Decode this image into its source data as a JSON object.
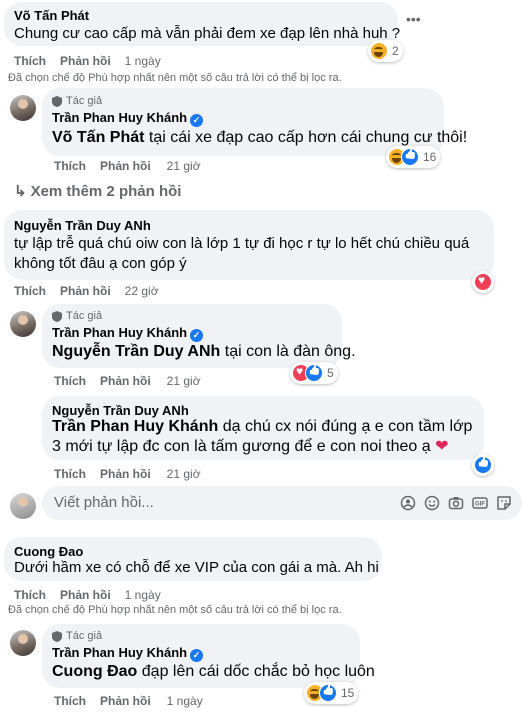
{
  "comments": {
    "c1": {
      "author": "Võ Tấn Phát",
      "text": "Chung cư cao cấp mà vẫn phải đem xe đạp lên nhà huh ?",
      "like": "Thích",
      "reply": "Phản hồi",
      "time": "1 ngày",
      "reaction_count": "2",
      "filter_note": "Đã chọn chế độ Phù hợp nhất nên một số câu trả lời có thể bị lọc ra."
    },
    "r1": {
      "badge": "Tác giả",
      "author": "Trần Phan Huy Khánh",
      "mention": "Võ Tấn Phát",
      "text": " tại cái xe đạp cao cấp hơn cái chung cư thôi!",
      "like": "Thích",
      "reply": "Phản hồi",
      "time": "21 giờ",
      "reaction_count": "16"
    },
    "see_more": "Xem thêm 2 phản hồi",
    "c2": {
      "author": "Nguyễn Trần Duy ANh",
      "text": "tự lập trễ quá chú oiw con là lớp 1 tự đi học r tự lo hết chú chiều quá không tốt đâu ạ con góp ý",
      "like": "Thích",
      "reply": "Phản hồi",
      "time": "22 giờ"
    },
    "r2": {
      "badge": "Tác giả",
      "author": "Trần Phan Huy Khánh",
      "mention": "Nguyễn Trần Duy ANh",
      "text": " tại con là đàn ông.",
      "like": "Thích",
      "reply": "Phản hồi",
      "time": "21 giờ",
      "reaction_count": "5"
    },
    "r3": {
      "author": "Nguyễn Trần Duy ANh",
      "mention": "Trần Phan Huy Khánh",
      "text": " dạ chú cx nói đúng ạ e con tầm lớp 3 mới tự lập đc con là tấm gương để e con noi theo ạ ",
      "heart": "❤",
      "like": "Thích",
      "reply": "Phản hồi",
      "time": "21 giờ"
    },
    "reply_placeholder": "Viết phản hồi...",
    "c3": {
      "author": "Cuong Đao",
      "text": "Dưới hầm xe có chỗ để xe VIP của con gái a mà. Ah hi",
      "like": "Thích",
      "reply": "Phản hồi",
      "time": "1 ngày",
      "filter_note": "Đã chọn chế độ Phù hợp nhất nên một số câu trả lời có thể bị lọc ra."
    },
    "r4": {
      "badge": "Tác giả",
      "author": "Trần Phan Huy Khánh",
      "mention": "Cuong Đao",
      "text": " đạp lên cái dốc chắc bỏ học luôn",
      "like": "Thích",
      "reply": "Phản hồi",
      "time": "1 ngày",
      "reaction_count": "15"
    }
  },
  "icons": {
    "more": "three-dots-icon",
    "gif": "GIF"
  },
  "colors": {
    "bubble": "#f0f2f5",
    "verified": "#1877f2",
    "secondary_text": "#65676b"
  }
}
